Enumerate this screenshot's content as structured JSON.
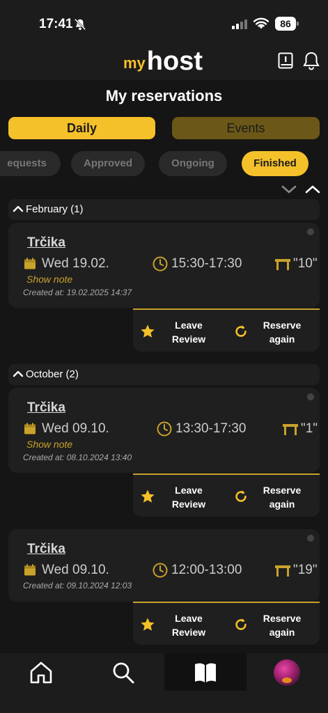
{
  "status": {
    "time": "17:41",
    "battery": "86"
  },
  "header": {
    "logo_my": "my",
    "logo_host": "host",
    "info_icon": "info-book-icon",
    "bell_icon": "bell-icon"
  },
  "page": {
    "title": "My reservations"
  },
  "segments": {
    "daily": "Daily",
    "events": "Events",
    "selected": "daily"
  },
  "filters": {
    "requests": "equests",
    "approved": "Approved",
    "ongoing": "Ongoing",
    "finished": "Finished",
    "selected": "finished"
  },
  "groups": [
    {
      "label": "February (1)",
      "reservations": [
        {
          "venue": "Trčika",
          "date": "Wed 19.02.",
          "time": "15:30-17:30",
          "table": "\"10\"",
          "note_link": "Show note",
          "created": "Created at: 19.02.2025 14:37"
        }
      ]
    },
    {
      "label": "October (2)",
      "reservations": [
        {
          "venue": "Trčika",
          "date": "Wed 09.10.",
          "time": "13:30-17:30",
          "table": "\"1\"",
          "note_link": "Show note",
          "created": "Created at: 08.10.2024 13:40"
        },
        {
          "venue": "Trčika",
          "date": "Wed 09.10.",
          "time": "12:00-13:00",
          "table": "\"19\"",
          "note_link": "",
          "created": "Created at: 09.10.2024 12:03"
        }
      ]
    }
  ],
  "actions": {
    "leave_review_line1": "Leave",
    "leave_review_line2": "Review",
    "reserve_line1": "Reserve",
    "reserve_line2": "again"
  },
  "nav": {
    "items": [
      "home-icon",
      "search-icon",
      "reservations-book-icon",
      "profile-avatar"
    ],
    "selected": "reservations"
  },
  "colors": {
    "accent": "#f5c12a",
    "accent_dim": "#6b5717",
    "background": "#151515",
    "card": "#1f1f1f"
  }
}
